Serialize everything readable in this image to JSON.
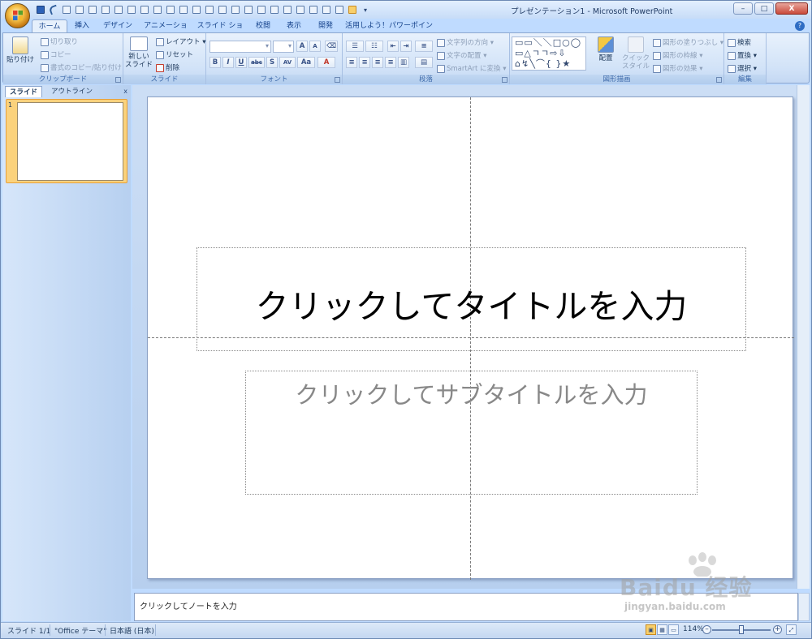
{
  "window": {
    "title": "プレゼンテーション1 - Microsoft PowerPoint",
    "buttons": {
      "minimize": "–",
      "maximize": "□",
      "close": "X"
    }
  },
  "tabs": [
    {
      "label": "ホーム",
      "active": true
    },
    {
      "label": "挿入"
    },
    {
      "label": "デザイン"
    },
    {
      "label": "アニメーション"
    },
    {
      "label": "スライド ショー"
    },
    {
      "label": "校閲"
    },
    {
      "label": "表示"
    },
    {
      "label": "開発"
    },
    {
      "label": "活用しよう！パワーポイント"
    }
  ],
  "ribbon": {
    "clipboard": {
      "paste": "貼り付け",
      "cut": "切り取り",
      "copy": "コピー",
      "format_painter": "書式のコピー/貼り付け",
      "group_label": "クリップボード"
    },
    "slides": {
      "new_slide": "新しい スライド",
      "layout": "レイアウト",
      "reset": "リセット",
      "delete": "削除",
      "group_label": "スライド"
    },
    "font": {
      "group_label": "フォント",
      "bold": "B",
      "italic": "I",
      "underline": "U",
      "strike": "abc",
      "shadow": "S",
      "spacing": "AV",
      "case": "Aa",
      "color": "A",
      "grow": "A",
      "shrink": "A"
    },
    "paragraph": {
      "text_direction": "文字列の方向",
      "align_text": "文字の配置",
      "smartart": "SmartArt に変換",
      "group_label": "段落"
    },
    "drawing": {
      "shapes": "▭▭＼＼□○◯ ▭△ㄱㄱ⇨⇩ ⌂↯╲⌒{ }★",
      "arrange": "配置",
      "quick_styles": "クイック スタイル",
      "shape_fill": "図形の塗りつぶし",
      "shape_outline": "図形の枠線",
      "shape_effects": "図形の効果",
      "group_label": "図形描画"
    },
    "editing": {
      "find": "検索",
      "replace": "置換",
      "select": "選択",
      "group_label": "編集"
    }
  },
  "left_pane": {
    "tab_slides": "スライド",
    "tab_outline": "アウトライン",
    "close": "x",
    "thumb_number": "1"
  },
  "slide": {
    "title_placeholder": "クリックしてタイトルを入力",
    "subtitle_placeholder": "クリックしてサブタイトルを入力"
  },
  "notes": {
    "placeholder": "クリックしてノートを入力"
  },
  "status": {
    "slide": "スライド 1/1",
    "theme": "\"Office テーマ\"",
    "language": "日本語 (日本)",
    "zoom": "114%"
  },
  "watermark": {
    "brand": "Baidu 经验",
    "url": "jingyan.baidu.com"
  },
  "colors": {
    "ribbon": "#d2e3f8",
    "frame": "#bfdbff",
    "accent_orange": "#f8cf6b"
  }
}
